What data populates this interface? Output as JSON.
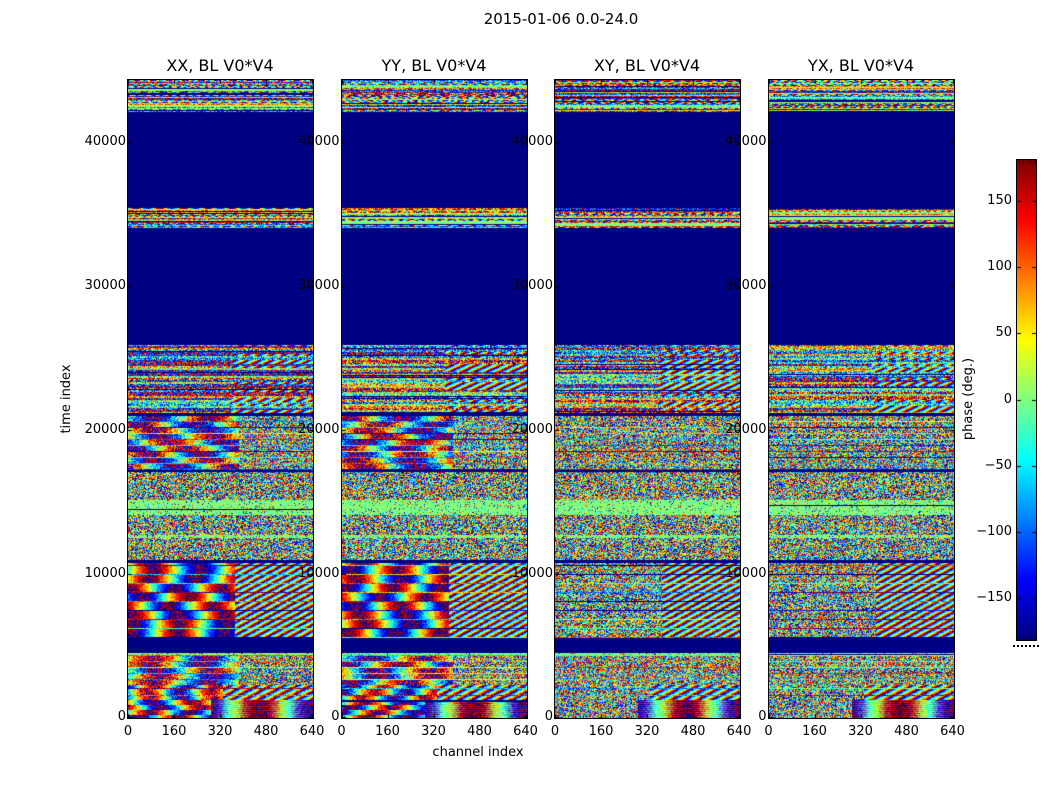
{
  "chart_data": {
    "type": "heatmap",
    "title": "2015-01-06 0.0-24.0",
    "xlabel": "channel index",
    "ylabel": "time index",
    "x_range": [
      0,
      640
    ],
    "y_range": [
      0,
      44330
    ],
    "x_ticks": [
      0,
      160,
      320,
      480,
      640
    ],
    "y_ticks": [
      0,
      10000,
      20000,
      30000,
      40000
    ],
    "grid": false,
    "panels": [
      {
        "title": "XX, BL V0*V4",
        "pol": "XX",
        "coherent": true
      },
      {
        "title": "YY, BL V0*V4",
        "pol": "YY",
        "coherent": true
      },
      {
        "title": "XY, BL V0*V4",
        "pol": "XY",
        "coherent": false
      },
      {
        "title": "YX, BL V0*V4",
        "pol": "YX",
        "coherent": false
      }
    ],
    "colorbar": {
      "label": "phase (deg.)",
      "ticks": [
        150,
        100,
        50,
        0,
        -50,
        -100,
        -150
      ],
      "range": [
        -180,
        180
      ],
      "colormap": "jet",
      "tick_side": "left"
    },
    "bands": [
      {
        "to": 44330,
        "from": 42100,
        "type": "stripes"
      },
      {
        "to": 42100,
        "from": 35430,
        "type": "flagged"
      },
      {
        "to": 35430,
        "from": 34040,
        "type": "stripes"
      },
      {
        "to": 34040,
        "from": 25900,
        "type": "flagged"
      },
      {
        "to": 25900,
        "from": 21180,
        "type": "dense"
      },
      {
        "to": 21180,
        "from": 20970,
        "type": "flagged"
      },
      {
        "to": 20970,
        "from": 17210,
        "type": "noiseblob"
      },
      {
        "to": 17210,
        "from": 17070,
        "type": "flagged"
      },
      {
        "to": 17070,
        "from": 15120,
        "type": "noise"
      },
      {
        "to": 15120,
        "from": 14080,
        "type": "green"
      },
      {
        "to": 14080,
        "from": 12690,
        "type": "noise"
      },
      {
        "to": 12690,
        "from": 12480,
        "type": "green"
      },
      {
        "to": 12480,
        "from": 10950,
        "type": "noise"
      },
      {
        "to": 10950,
        "from": 10740,
        "type": "flagged"
      },
      {
        "to": 10740,
        "from": 5530,
        "type": "blob"
      },
      {
        "to": 5530,
        "from": 4485,
        "type": "flagged"
      },
      {
        "to": 4485,
        "from": 4346,
        "type": "green"
      },
      {
        "to": 4346,
        "from": 2260,
        "type": "noiseblob"
      },
      {
        "to": 2260,
        "from": 1217,
        "type": "blob2"
      },
      {
        "to": 1217,
        "from": 0,
        "type": "herringbone"
      }
    ],
    "colors": {
      "flagged_navy": "#000084",
      "background": "#ffffff",
      "text": "#000000"
    }
  }
}
